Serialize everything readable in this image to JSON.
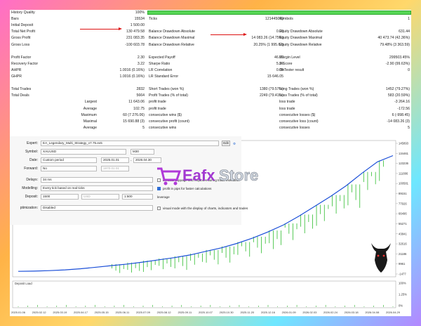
{
  "stats": {
    "rows": [
      {
        "cells": [
          [
            "History Quality",
            "100%"
          ],
          [
            "",
            ""
          ],
          [
            "",
            ""
          ]
        ]
      },
      {
        "cells": [
          [
            "Bars",
            "15534"
          ],
          [
            "Ticks",
            "121445049"
          ],
          [
            "Symbols",
            "1"
          ]
        ]
      },
      {
        "cells": [
          [
            "Initial Deposit",
            "1 500.00"
          ],
          [
            "",
            ""
          ],
          [
            "",
            ""
          ]
        ]
      },
      {
        "cells": [
          [
            "Total Net Profit",
            "130 479.58"
          ],
          [
            "Balance Drawdown Absolute",
            "0.00"
          ],
          [
            "Equity Drawdown Absolute",
            "631.44"
          ]
        ]
      },
      {
        "cells": [
          [
            "Gross Profit",
            "231 083.35"
          ],
          [
            "Balance Drawdown Maximal",
            "14 083.26 (14.75%)"
          ],
          [
            "Equity Drawdown Maximal",
            "40 473.74 (42.36%)"
          ]
        ]
      },
      {
        "cells": [
          [
            "Gross Loss",
            "-100 603.78"
          ],
          [
            "Balance Drawdown Relative",
            "20.25% (1 995.62)"
          ],
          [
            "Equity Drawdown Relative",
            "79.48% (3 363.59)"
          ]
        ]
      },
      {
        "cells": [
          [
            "",
            ""
          ],
          [
            "",
            ""
          ],
          [
            "",
            ""
          ]
        ]
      },
      {
        "cells": [
          [
            "Profit Factor",
            "2.30"
          ],
          [
            "Expected Payoff",
            "46.07"
          ],
          [
            "Margin Level",
            "299503.45%"
          ]
        ]
      },
      {
        "cells": [
          [
            "Recovery Factor",
            "3.22"
          ],
          [
            "Sharpe Ratio",
            "5.96"
          ],
          [
            "Z-Score",
            "-2.90 (99.63%)"
          ]
        ]
      },
      {
        "cells": [
          [
            "AHPR",
            "1.0016 (0.16%)"
          ],
          [
            "LR Correlation",
            "0.89"
          ],
          [
            "OnTester result",
            "0"
          ]
        ]
      },
      {
        "cells": [
          [
            "GHPR",
            "1.0016 (0.16%)"
          ],
          [
            "LR Standard Error",
            "15 646.05"
          ],
          [
            "",
            ""
          ]
        ]
      },
      {
        "cells": [
          [
            "",
            ""
          ],
          [
            "",
            ""
          ],
          [
            "",
            ""
          ]
        ]
      },
      {
        "cells": [
          [
            "Total Trades",
            "2832"
          ],
          [
            "Short Trades (won %)",
            "1380 (79.57%)"
          ],
          [
            "Long Trades (won %)",
            "1452 (79.27%)"
          ]
        ]
      },
      {
        "cells": [
          [
            "Total Deals",
            "5664"
          ],
          [
            "Profit Trades (% of total)",
            "2249 (79.41%)"
          ],
          [
            "Loss Trades (% of total)",
            "583 (20.59%)"
          ]
        ]
      },
      {
        "cells": [
          [
            "Largest",
            "11 643.06"
          ],
          [
            "profit trade",
            "loss trade"
          ],
          [
            "-3 264.16",
            ""
          ]
        ]
      },
      {
        "cells": [
          [
            "Average",
            "102.75"
          ],
          [
            "profit trade",
            "loss trade"
          ],
          [
            "-172.56",
            ""
          ]
        ]
      },
      {
        "cells": [
          [
            "Maximum",
            "60 (7 276.06)"
          ],
          [
            "consecutive wins ($)",
            "consecutive losses ($)"
          ],
          [
            "6 (-998.45)",
            ""
          ]
        ]
      },
      {
        "cells": [
          [
            "Maximal",
            "15 690.88 (3)"
          ],
          [
            "consecutive profit (count)",
            "consecutive loss (count)"
          ],
          [
            "-14 083.26 (3)",
            ""
          ]
        ]
      },
      {
        "cells": [
          [
            "Average",
            "5"
          ],
          [
            "consecutive wins",
            "consecutive losses"
          ],
          [
            "5",
            ""
          ]
        ]
      }
    ]
  },
  "settings": {
    "expert_label": "Expert:",
    "expert_value": "EA_Legendary_Multi_Strategy_v7.75.ex5",
    "symbol_label": "Symbol:",
    "symbol_value": "XAUUSD",
    "timeframe": "M30",
    "date_label": "Date:",
    "date_mode": "Custom period",
    "date_from": "2025.01.01",
    "date_to": "2026.04.30",
    "forward_label": "Forward:",
    "forward_value": "No",
    "forward_date": "1970.01.01",
    "delays_label": "Delays:",
    "delays_value": "34 ms",
    "delays_note": "emulate slippage and requotes during trade execution",
    "modelling_label": "Modelling:",
    "modelling_value": "Every tick based on real ticks",
    "modelling_note": "profit in pips for faster calculations",
    "deposit_label": "Deposit:",
    "deposit_value": "1500",
    "deposit_currency": "USD",
    "leverage_value": "1:500",
    "leverage_label": "leverage",
    "optimization_label": "ptimization:",
    "optimization_value": "Disabled",
    "visual_note": "visual mode with the display of charts, indicators and trades",
    "edit_btn": "Edit"
  },
  "logo": {
    "text_a": "Eafx",
    "text_b": "Store"
  },
  "chart_data": {
    "type": "line",
    "series": [
      {
        "values": [
          1500,
          1800,
          2300,
          3200,
          4500,
          6200,
          8000,
          9800,
          12000,
          14500,
          17000,
          20000,
          24000,
          28000,
          33000,
          39000,
          46000,
          54000,
          64000,
          75000,
          86000,
          98000,
          112000,
          125000,
          132000
        ]
      }
    ],
    "y_ticks": [
      "145893",
      "134461",
      "123236",
      "111806",
      "100581",
      "89151",
      "77926",
      "66496",
      "55271",
      "43841",
      "32616",
      "21186",
      "9961",
      "-1477"
    ],
    "x_ticks": [
      "2025.01.06",
      "2025.02.12",
      "2025.03.19",
      "2025.04.17",
      "2025.05.15",
      "2025.06.11",
      "2025.07.09",
      "2025.08.12",
      "2025.09.11",
      "2025.10.07",
      "2025.10.30",
      "2025.11.20",
      "2025.12.16",
      "2026.01.09",
      "2026.02.03",
      "2026.02.24",
      "2026.03.18",
      "2026.04.08",
      "2026.04.29"
    ],
    "load_label": "Deposit Load",
    "load_ticks": [
      "100%",
      "1.25%",
      "0%"
    ],
    "colors": {
      "balance": "#1b4fd8",
      "equity": "#27b324",
      "volume": "#2fbd2f"
    }
  }
}
